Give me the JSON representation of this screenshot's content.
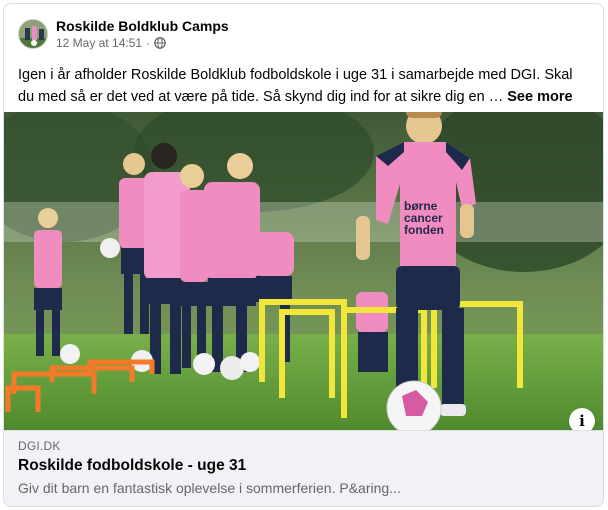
{
  "post": {
    "page_name": "Roskilde Boldklub Camps",
    "timestamp": "12 May at 14:51",
    "separator": "·",
    "audience_icon": "globe-icon",
    "text": "Igen i år afholder Roskilde Boldklub fodboldskole i uge 31 i samarbejde med DGI. Skal du med så er det ved at være på tide. Så skynd dig ind for at sikre dig en …",
    "see_more_label": "See more"
  },
  "photo": {
    "shirt_print": [
      "børne",
      "cancer",
      "fonden"
    ],
    "info_icon": "i"
  },
  "link_preview": {
    "domain": "DGI.DK",
    "title": "Roskilde fodboldskole - uge 31",
    "description": "Giv dit barn en fantastisk oplevelse i sommerferien. P&aring..."
  },
  "colors": {
    "grass": "#5e9a3a",
    "jersey_pink": "#f08cc0",
    "kit_navy": "#1e2a4a",
    "hurdle_yellow": "#f2e63a",
    "hurdle_orange": "#f47a2a"
  }
}
